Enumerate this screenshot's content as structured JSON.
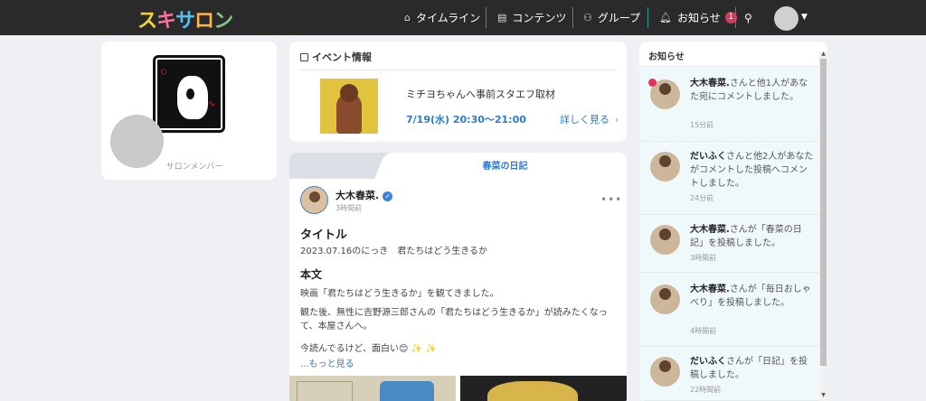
{
  "header": {
    "logo_text": "スキサロン",
    "nav": [
      {
        "icon": "home-icon",
        "label": "タイムライン"
      },
      {
        "icon": "book-icon",
        "label": "コンテンツ"
      },
      {
        "icon": "group-icon",
        "label": "グループ"
      },
      {
        "icon": "bell-icon",
        "label": "お知らせ",
        "badge": "1"
      }
    ],
    "search_icon": "search-icon"
  },
  "profile": {
    "role_label": "サロンメンバー"
  },
  "event": {
    "heading": "イベント情報",
    "title": "ミチヨちゃんへ事前スタエフ取材",
    "time": "7/19(水) 20:30〜21:00",
    "more_label": "詳しく見る"
  },
  "feed": {
    "tab_label": "春菜の日記",
    "post": {
      "author": "大木春菜.",
      "time": "3時間前",
      "title_label": "タイトル",
      "title_value": "2023.07.16のにっき　君たちはどう生きるか",
      "body_label": "本文",
      "p1": "映画「君たちはどう生きるか」を観てきました。",
      "p2": "観た後、無性に吉野源三郎さんの「君たちはどう生きるか」が読みたくなって、本屋さんへ。",
      "p3": "今読んでるけど、面白い😊 ✨ ✨",
      "more_label": "...もっと見る"
    }
  },
  "notices": {
    "heading": "お知らせ",
    "items": [
      {
        "name": "大木春菜.",
        "text": "さんと他1人があなた宛にコメントしました。",
        "time": "15分前",
        "unread": true
      },
      {
        "name": "だいふく",
        "text": "さんと他2人があなたがコメントした投稿へコメントしました。",
        "time": "24分前"
      },
      {
        "name": "大木春菜.",
        "text": "さんが「春菜の日記」を投稿しました。",
        "time": "3時間前"
      },
      {
        "name": "大木春菜.",
        "text": "さんが「毎日おしゃべり」を投稿しました。",
        "time": "4時間前"
      },
      {
        "name": "だいふく",
        "text": "さんが「日記」を投稿しました。",
        "time": "22時間前"
      }
    ]
  }
}
